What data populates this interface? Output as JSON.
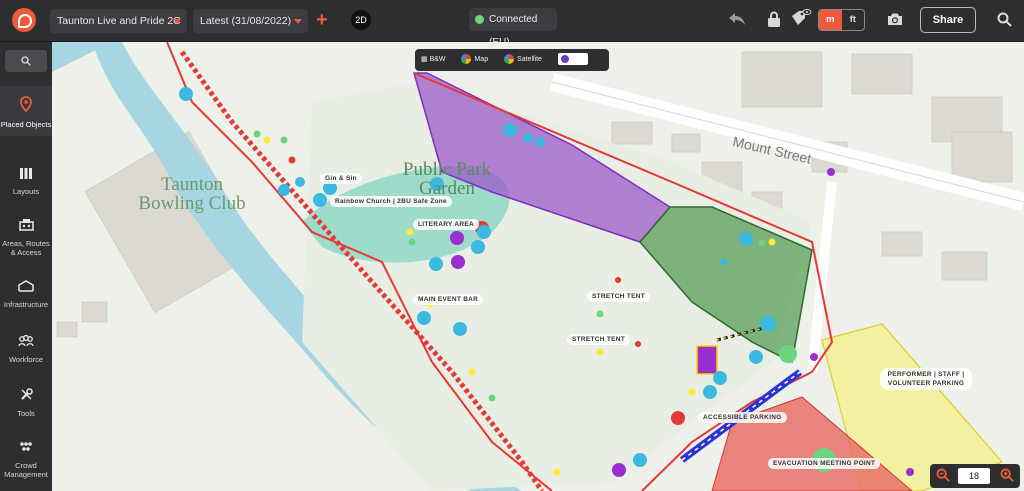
{
  "header": {
    "event_select": "Taunton Live and Pride 2C",
    "version_select": "Latest (31/08/2022)",
    "add_label": "+",
    "view_mode": "2D",
    "connection_status": "Connected (EU)",
    "units": {
      "metric": "m",
      "imperial": "ft",
      "selected": "m"
    },
    "share_label": "Share"
  },
  "sidebar": {
    "items": [
      {
        "label": "Placed Objects",
        "icon": "map-pin-icon",
        "active": true
      },
      {
        "label": "Layouts",
        "icon": "layouts-icon"
      },
      {
        "label": "Areas, Routes & Access",
        "icon": "areas-icon"
      },
      {
        "label": "Infrastructure",
        "icon": "infrastructure-icon"
      },
      {
        "label": "Workforce",
        "icon": "workforce-icon"
      },
      {
        "label": "Tools",
        "icon": "tools-icon"
      },
      {
        "label": "Crowd Management",
        "icon": "crowd-icon"
      }
    ]
  },
  "map": {
    "layers": {
      "bw": "B&W",
      "map": "Map",
      "satellite": "Satellite"
    },
    "basemap_labels": {
      "bowling_club": "Taunton Bowling Club",
      "park": "Public Park Garden",
      "street": "Mount Street"
    },
    "zones": {
      "gin_sin": "Gin & Sin",
      "rainbow_church": "Rainbow Church | 2BU Safe Zone",
      "literary_area": "LITERARY AREA",
      "main_event_bar": "MAIN EVENT BAR",
      "stretch_tent_1": "STRETCH TENT",
      "stretch_tent_2": "STRETCH TENT",
      "accessible_parking": "ACCESSIBLE PARKING",
      "performer_parking": "PERFORMER | STAFF | VOLUNTEER PARKING",
      "evacuation_point": "EVACUATION MEETING POINT"
    },
    "zoom": {
      "level": "18"
    },
    "colors": {
      "accent": "#ef5a3c",
      "purple_zone": "#9b59c9",
      "green_zone": "#4f9a4f",
      "teal_zone": "#7fd3c0",
      "yellow_zone": "#f6f08a",
      "red_zone": "#e8716a",
      "route_red": "#e53935",
      "accessible_blue": "#2b34d4"
    }
  }
}
